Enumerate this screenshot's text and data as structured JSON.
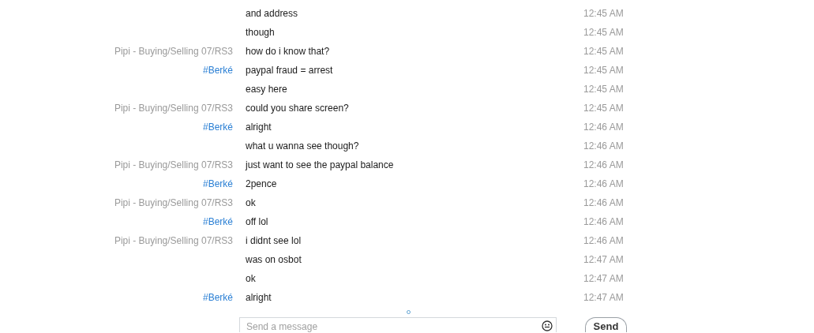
{
  "messages": [
    {
      "text": "and address",
      "time": "12:45 AM"
    },
    {
      "text": "though",
      "time": "12:45 AM"
    },
    {
      "sender": "Pipi - Buying/Selling 07/RS3",
      "kind": "other",
      "text": "how do i know that?",
      "time": "12:45 AM"
    },
    {
      "sender": "#Berké",
      "kind": "me",
      "text": "paypal fraud = arrest",
      "time": "12:45 AM"
    },
    {
      "text": "easy here",
      "time": "12:45 AM"
    },
    {
      "sender": "Pipi - Buying/Selling 07/RS3",
      "kind": "other",
      "text": "could you share screen?",
      "time": "12:45 AM"
    },
    {
      "sender": "#Berké",
      "kind": "me",
      "text": "alright",
      "time": "12:46 AM"
    },
    {
      "text": "what u wanna see though?",
      "time": "12:46 AM"
    },
    {
      "sender": "Pipi - Buying/Selling 07/RS3",
      "kind": "other",
      "text": "just want to see the paypal balance",
      "time": "12:46 AM"
    },
    {
      "sender": "#Berké",
      "kind": "me",
      "text": "2pence",
      "time": "12:46 AM"
    },
    {
      "sender": "Pipi - Buying/Selling 07/RS3",
      "kind": "other",
      "text": "ok",
      "time": "12:46 AM"
    },
    {
      "sender": "#Berké",
      "kind": "me",
      "text": "off lol",
      "time": "12:46 AM"
    },
    {
      "sender": "Pipi - Buying/Selling 07/RS3",
      "kind": "other",
      "text": "i didnt see lol",
      "time": "12:46 AM"
    },
    {
      "text": "was on osbot",
      "time": "12:47 AM"
    },
    {
      "text": "ok",
      "time": "12:47 AM"
    },
    {
      "sender": "#Berké",
      "kind": "me",
      "text": "alright",
      "time": "12:47 AM"
    }
  ],
  "composer": {
    "placeholder": "Send a message",
    "send": "Send"
  }
}
